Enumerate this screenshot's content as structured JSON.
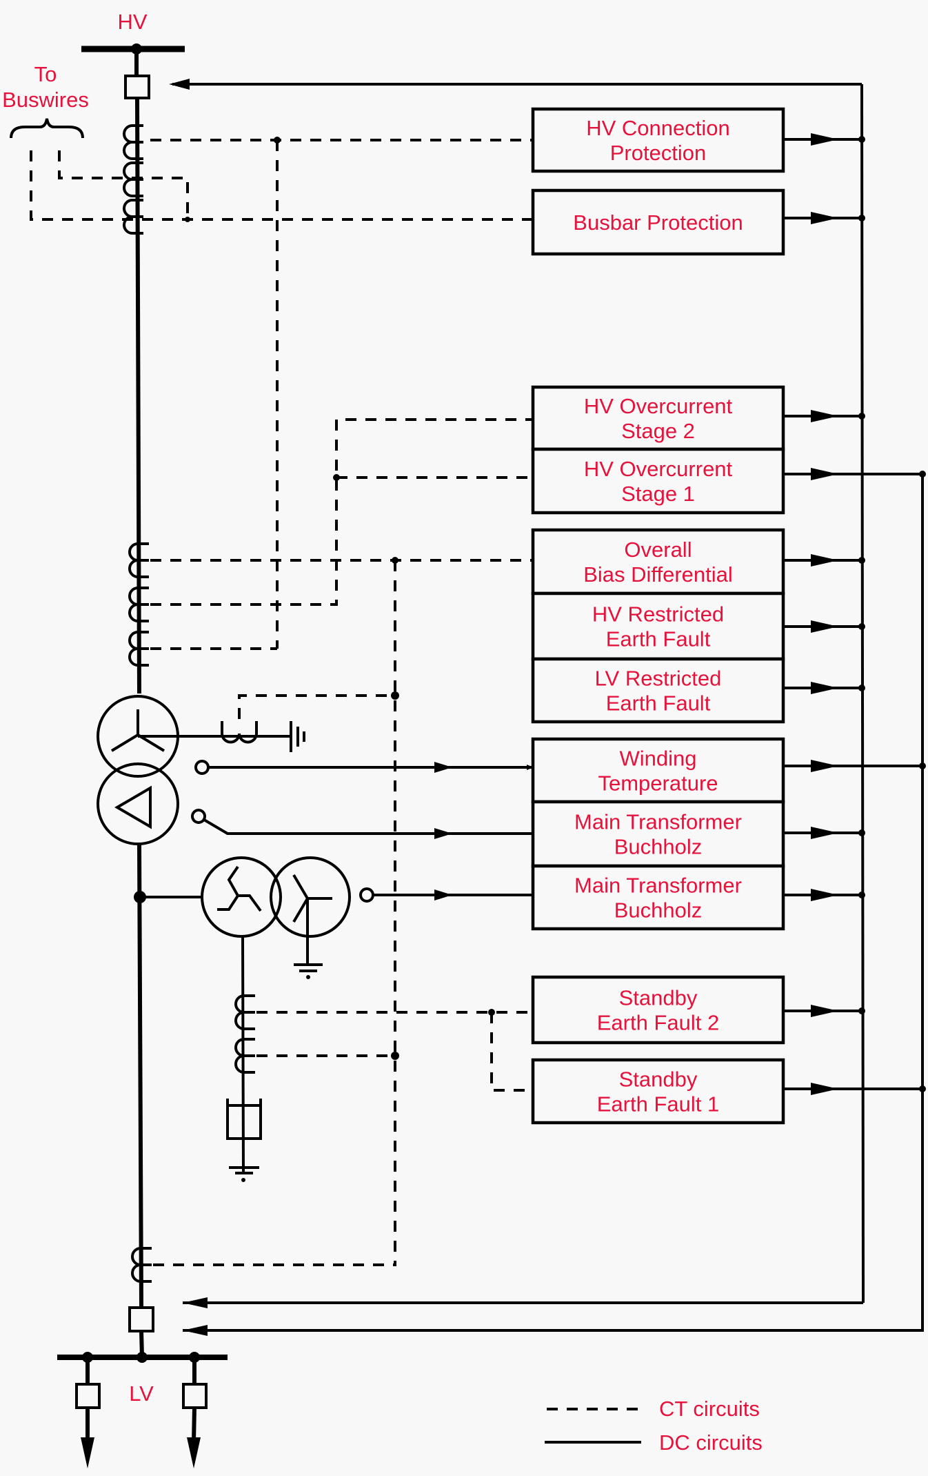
{
  "labels": {
    "hv": "HV",
    "lv": "LV",
    "to_buswires": [
      "To",
      "Buswires"
    ]
  },
  "relays": [
    {
      "id": "hv-connection-protection",
      "lines": [
        "HV Connection",
        "Protection"
      ]
    },
    {
      "id": "busbar-protection",
      "lines": [
        "Busbar Protection"
      ]
    },
    {
      "id": "hv-overcurrent-stage-2",
      "lines": [
        "HV Overcurrent",
        "Stage 2"
      ]
    },
    {
      "id": "hv-overcurrent-stage-1",
      "lines": [
        "HV Overcurrent",
        "Stage 1"
      ]
    },
    {
      "id": "overall-bias-differential",
      "lines": [
        "Overall",
        "Bias Differential"
      ]
    },
    {
      "id": "hv-restricted-earth-fault",
      "lines": [
        "HV Restricted",
        "Earth Fault"
      ]
    },
    {
      "id": "lv-restricted-earth-fault",
      "lines": [
        "LV Restricted",
        "Earth Fault"
      ]
    },
    {
      "id": "winding-temperature",
      "lines": [
        "Winding",
        "Temperature"
      ]
    },
    {
      "id": "main-transformer-buchholz-1",
      "lines": [
        "Main Transformer",
        "Buchholz"
      ]
    },
    {
      "id": "main-transformer-buchholz-2",
      "lines": [
        "Main Transformer",
        "Buchholz"
      ]
    },
    {
      "id": "standby-earth-fault-2",
      "lines": [
        "Standby",
        "Earth Fault 2"
      ]
    },
    {
      "id": "standby-earth-fault-1",
      "lines": [
        "Standby",
        "Earth Fault 1"
      ]
    }
  ],
  "legend": [
    {
      "style": "dashed",
      "label": "CT circuits"
    },
    {
      "style": "solid",
      "label": "DC circuits"
    }
  ],
  "colors": {
    "label": "#e5123c",
    "line": "#000000",
    "background": "#f8f8f8"
  }
}
